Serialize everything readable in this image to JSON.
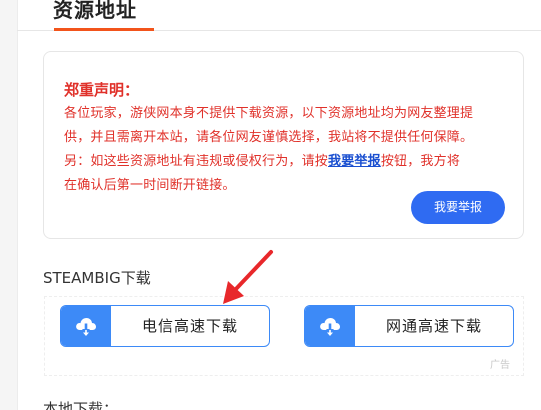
{
  "section": {
    "title": "资源地址"
  },
  "notice": {
    "title": "郑重声明：",
    "line1": "各位玩家，游侠网本身不提供下载资源，以下资源地址均为网友整理提",
    "line2": "供，并且需离开本站，请各位网友谨慎选择，我站将不提供任何保障。",
    "line3_prefix": "另：如这些资源地址有违规或侵权行为，请按",
    "line3_link": "我要举报",
    "line3_suffix": "按钮，我方将",
    "line4": "在确认后第一时间断开链接。",
    "report_button": "我要举报"
  },
  "steam": {
    "label": "STEAMBIG下载"
  },
  "downloads": {
    "telecom_label": "电信高速下载",
    "netcom_label": "网通高速下载",
    "ad_label": "广告",
    "button_icon": "cloud-download-icon"
  },
  "local": {
    "label": "本地下载："
  },
  "colors": {
    "accent": "#f2541b",
    "notice_red": "#e0312a",
    "link_blue": "#1a4fd0",
    "button_blue": "#2f6bf2",
    "download_blue": "#3d8af7",
    "arrow_red": "#e8282b"
  }
}
